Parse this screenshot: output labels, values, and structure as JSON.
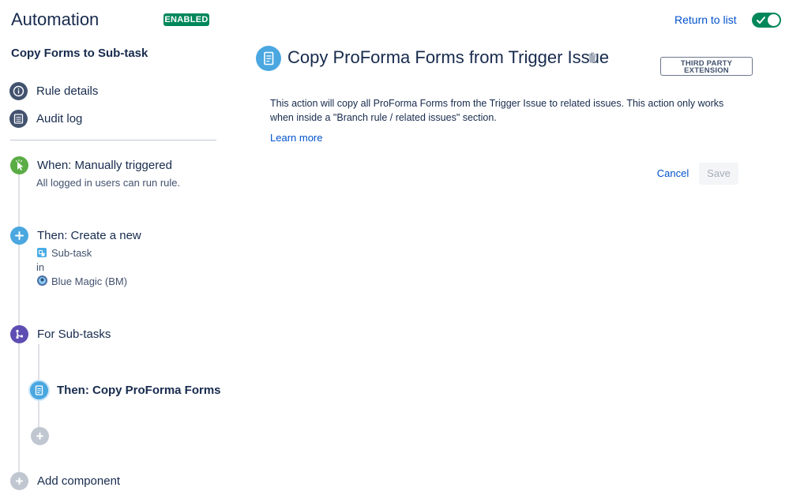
{
  "header": {
    "title": "Automation",
    "status_badge": "ENABLED",
    "return_link": "Return to list",
    "rule_enabled": true
  },
  "sidebar": {
    "rule_name": "Copy Forms to Sub-task",
    "nav": [
      {
        "label": "Rule details",
        "icon": "info-icon"
      },
      {
        "label": "Audit log",
        "icon": "list-icon"
      }
    ],
    "steps": {
      "trigger": {
        "title": "When: Manually triggered",
        "subtitle": "All logged in users can run rule.",
        "icon": "pointer-icon",
        "color": "#5aac44"
      },
      "create": {
        "title": "Then: Create a new",
        "issue_type": "Sub-task",
        "connector": "in",
        "project": "Blue Magic (BM)",
        "icon": "plus-icon",
        "color": "#4aa7e0"
      },
      "branch": {
        "title": "For Sub-tasks",
        "icon": "branch-icon",
        "color": "#5e4db2"
      },
      "branch_action": {
        "title": "Then: Copy ProForma Forms",
        "icon": "form-icon",
        "color": "#4aa7e0"
      },
      "add_component": {
        "label": "Add component",
        "icon": "plus-icon",
        "color": "#c1c7d0"
      }
    }
  },
  "main": {
    "title": "Copy ProForma Forms from Trigger Issue",
    "badge_line1": "THIRD PARTY",
    "badge_line2": "EXTENSION",
    "description": "This action will copy all ProForma Forms from the Trigger Issue to related issues. This action only works when inside a \"Branch rule / related issues\" section.",
    "learn_more": "Learn more",
    "cancel": "Cancel",
    "save": "Save"
  },
  "colors": {
    "accent": "#0052cc",
    "enabled": "#00875a",
    "text": "#172b4d"
  }
}
